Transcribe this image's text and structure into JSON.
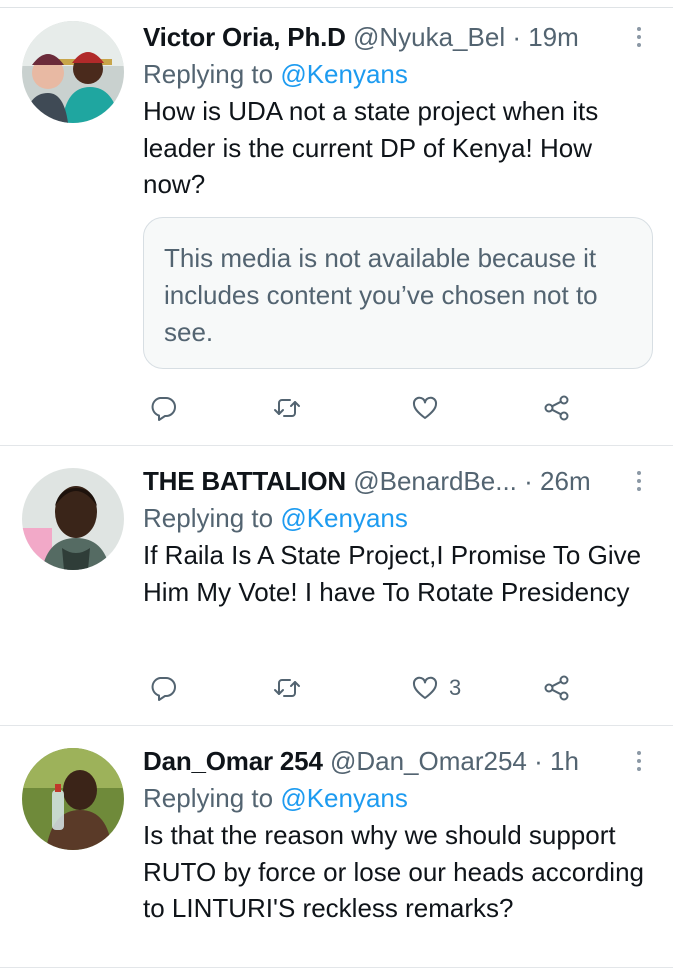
{
  "tweets": [
    {
      "name": "Victor Oria, Ph.D",
      "handle": "@Nyuka_Bel",
      "time": "· 19m",
      "replying_prefix": "Replying to",
      "replying_handle": "@Kenyans",
      "text": "How is UDA not a state project when its leader is the current DP of Kenya! How now?",
      "media_notice": "This media is not available because it includes content you’ve chosen not to see.",
      "like_count": ""
    },
    {
      "name": "THE BATTALION",
      "handle": "@BenardBe...",
      "time": "· 26m",
      "replying_prefix": "Replying to",
      "replying_handle": "@Kenyans",
      "text": "If Raila Is A State Project,I Promise To Give Him My Vote! I have To Rotate Presidency",
      "like_count": "3"
    },
    {
      "name": "Dan_Omar 254",
      "handle": "@Dan_Omar254",
      "time": "· 1h",
      "replying_prefix": "Replying to",
      "replying_handle": "@Kenyans",
      "text": "Is that the reason why we should support RUTO by force or lose our heads according to LINTURI'S reckless remarks?"
    }
  ],
  "icons": {
    "reply": "reply-bubble-icon",
    "retweet": "retweet-icon",
    "like": "heart-icon",
    "share": "share-icon",
    "more": "more-vertical-icon"
  },
  "colors": {
    "link": "#1d9bf0",
    "secondary_text": "#536471",
    "primary_text": "#0f1419"
  }
}
